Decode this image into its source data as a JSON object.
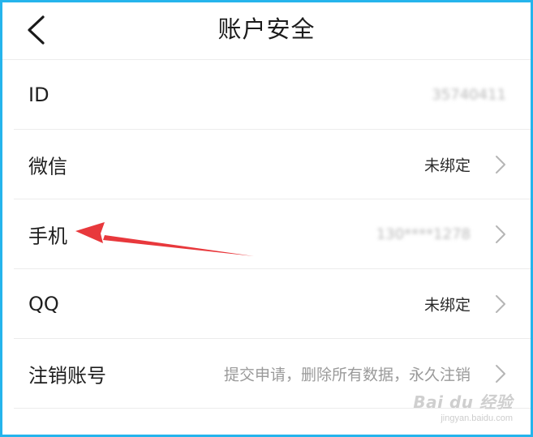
{
  "header": {
    "title": "账户安全",
    "back_icon": "chevron-left-icon"
  },
  "rows": [
    {
      "label": "ID",
      "value": "35740411"
    },
    {
      "label": "微信",
      "value": "未绑定"
    },
    {
      "label": "手机",
      "value": "130****1278"
    },
    {
      "label": "QQ",
      "value": "未绑定"
    },
    {
      "label": "注销账号",
      "value": "提交申请，删除所有数据，永久注销"
    }
  ],
  "colors": {
    "frame_border": "#25b4ec",
    "annotation_arrow": "#e8383c",
    "text_primary": "#1f1f1f",
    "text_secondary": "#9a9a9a"
  },
  "watermark": {
    "brand": "Bai du 经验",
    "url": "jingyan.baidu.com"
  }
}
